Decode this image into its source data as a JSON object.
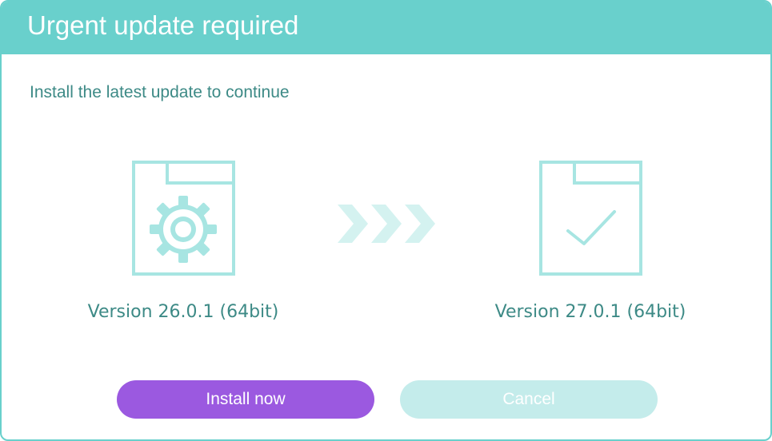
{
  "dialog": {
    "title": "Urgent update required",
    "message": "Install the latest update to continue"
  },
  "current_version": {
    "label": "Version 26.0.1 (64bit)",
    "icon": "settings-file-icon"
  },
  "new_version": {
    "label": "Version 27.0.1 (64bit)",
    "icon": "checked-file-icon"
  },
  "transition": {
    "icon": "triple-chevron-right-icon"
  },
  "buttons": {
    "install_label": "Install now",
    "cancel_label": "Cancel"
  },
  "colors": {
    "accent": "#69d0cc",
    "text": "#3d8a86",
    "primary_button": "#9b59e0",
    "secondary_button": "#c4eceb"
  }
}
